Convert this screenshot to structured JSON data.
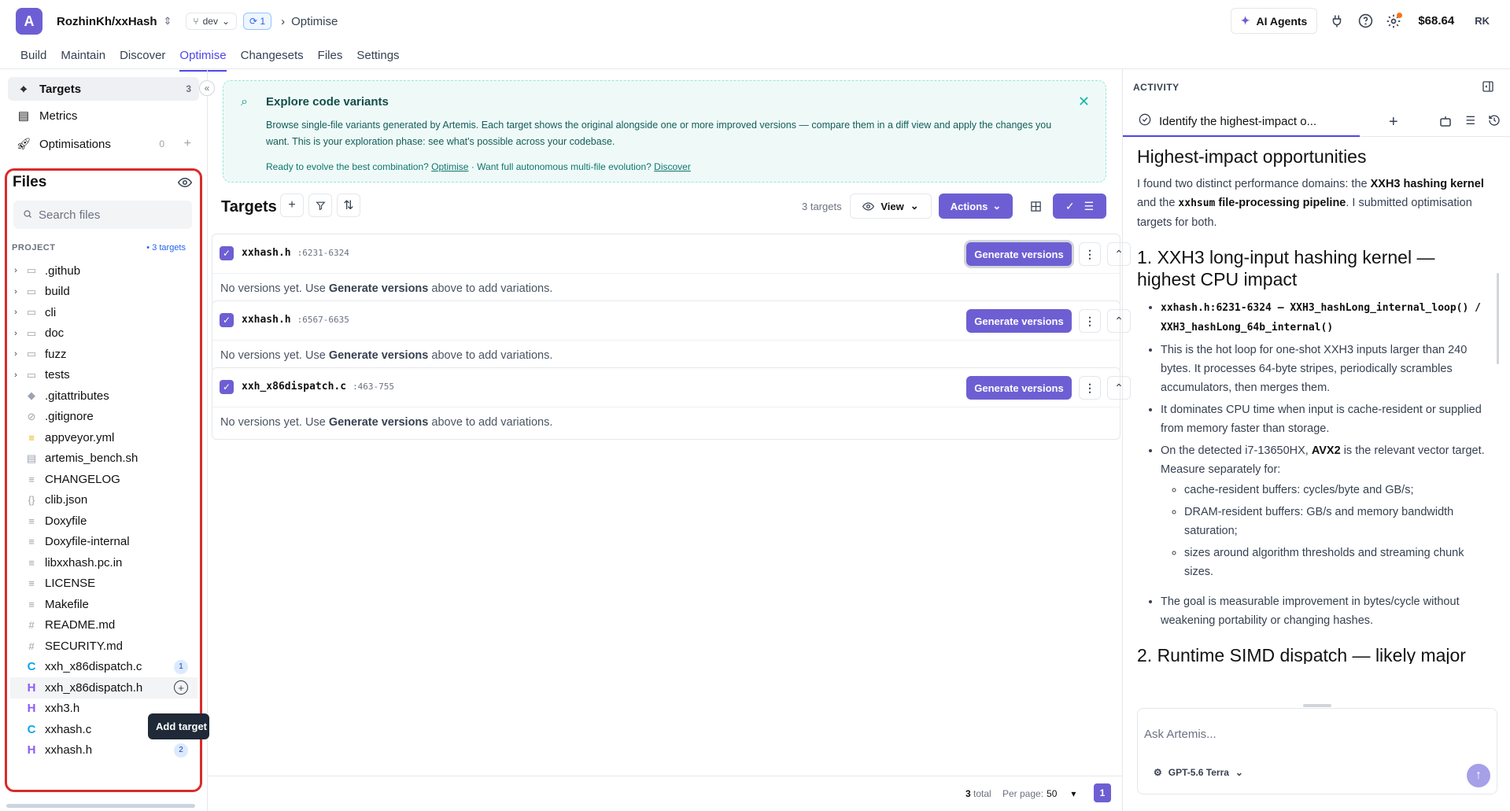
{
  "header": {
    "repo": "RozhinKh/xxHash",
    "branch": "dev",
    "sync_count": "1",
    "breadcrumb": "Optimise",
    "ai_agents_label": "AI Agents",
    "balance": "$68.64",
    "avatar_initials": "RK"
  },
  "tabs": [
    {
      "label": "Build"
    },
    {
      "label": "Maintain"
    },
    {
      "label": "Discover"
    },
    {
      "label": "Optimise",
      "active": true
    },
    {
      "label": "Changesets"
    },
    {
      "label": "Files"
    },
    {
      "label": "Settings"
    }
  ],
  "sidebar": {
    "nav": [
      {
        "label": "Targets",
        "count": "3"
      },
      {
        "label": "Metrics"
      },
      {
        "label": "Optimisations",
        "count": "0",
        "plus": "+"
      }
    ],
    "files_title": "Files",
    "search_placeholder": "Search files",
    "project_label": "PROJECT",
    "project_targets": "• 3 targets",
    "tree": [
      {
        "name": ".github",
        "type": "folder"
      },
      {
        "name": "build",
        "type": "folder"
      },
      {
        "name": "cli",
        "type": "folder"
      },
      {
        "name": "doc",
        "type": "folder"
      },
      {
        "name": "fuzz",
        "type": "folder"
      },
      {
        "name": "tests",
        "type": "folder"
      },
      {
        "name": ".gitattributes",
        "type": "file"
      },
      {
        "name": ".gitignore",
        "type": "file"
      },
      {
        "name": "appveyor.yml",
        "type": "file"
      },
      {
        "name": "artemis_bench.sh",
        "type": "file"
      },
      {
        "name": "CHANGELOG",
        "type": "file"
      },
      {
        "name": "clib.json",
        "type": "file"
      },
      {
        "name": "Doxyfile",
        "type": "file"
      },
      {
        "name": "Doxyfile-internal",
        "type": "file"
      },
      {
        "name": "libxxhash.pc.in",
        "type": "file"
      },
      {
        "name": "LICENSE",
        "type": "file"
      },
      {
        "name": "Makefile",
        "type": "file"
      },
      {
        "name": "README.md",
        "type": "file"
      },
      {
        "name": "SECURITY.md",
        "type": "file"
      },
      {
        "name": "xxh_x86dispatch.c",
        "type": "c",
        "badge": "1"
      },
      {
        "name": "xxh_x86dispatch.h",
        "type": "h"
      },
      {
        "name": "xxh3.h",
        "type": "h"
      },
      {
        "name": "xxhash.c",
        "type": "c"
      },
      {
        "name": "xxhash.h",
        "type": "h",
        "badge": "2"
      }
    ],
    "tooltip": "Add target"
  },
  "banner": {
    "title": "Explore code variants",
    "description": "Browse single-file variants generated by Artemis. Each target shows the original alongside one or more improved versions — compare them in a diff view and apply the changes you want. This is your exploration phase: see what's possible across your codebase.",
    "footer_prefix": "Ready to evolve the best combination?",
    "footer_link1": "Optimise",
    "footer_mid": "· Want full autonomous multi-file evolution?",
    "footer_link2": "Discover"
  },
  "targets": {
    "title": "Targets",
    "count_label": "3 targets",
    "view_label": "View",
    "actions_label": "Actions",
    "generate_label": "Generate versions",
    "empty_prefix": "No versions yet. Use",
    "empty_bold": "Generate versions",
    "empty_suffix": "above to add variations.",
    "items": [
      {
        "file": "xxhash.h",
        "range": ":6231-6324"
      },
      {
        "file": "xxhash.h",
        "range": ":6567-6635"
      },
      {
        "file": "xxh_x86dispatch.c",
        "range": ":463-755"
      }
    ],
    "footer": {
      "total_num": "3",
      "total_word": "total",
      "per_page_label": "Per page:",
      "per_page": "50",
      "page": "1"
    }
  },
  "activity": {
    "title": "ACTIVITY",
    "tab_label": "Identify the highest-impact o...",
    "h1": "Highest-impact opportunities",
    "intro_1": "I found two distinct performance domains: the",
    "intro_b1": "XXH3 hashing kernel",
    "intro_2": "and the",
    "intro_code": "xxhsum",
    "intro_b2": "file-processing pipeline",
    "intro_3": ". I submitted optimisation targets for both.",
    "h2a": "1. XXH3 long-input hashing kernel — highest CPU impact",
    "b1": "xxhash.h:6231-6324 — XXH3_hashLong_internal_loop() / XXH3_hashLong_64b_internal()",
    "b2": "This is the hot loop for one-shot XXH3 inputs larger than 240 bytes. It processes 64-byte stripes, periodically scrambles accumulators, then merges them.",
    "b3": "It dominates CPU time when input is cache-resident or supplied from memory faster than storage.",
    "b4_1": "On the detected i7-13650HX,",
    "b4_b": "AVX2",
    "b4_2": "is the relevant vector target. Measure separately for:",
    "s1": "cache-resident buffers: cycles/byte and GB/s;",
    "s2": "DRAM-resident buffers: GB/s and memory bandwidth saturation;",
    "s3": "sizes around algorithm thresholds and streaming chunk sizes.",
    "b5": "The goal is measurable improvement in bytes/cycle without weakening portability or changing hashes.",
    "h2b": "2. Runtime SIMD dispatch — likely major",
    "chat_placeholder": "Ask Artemis...",
    "model": "GPT-5.6 Terra"
  }
}
